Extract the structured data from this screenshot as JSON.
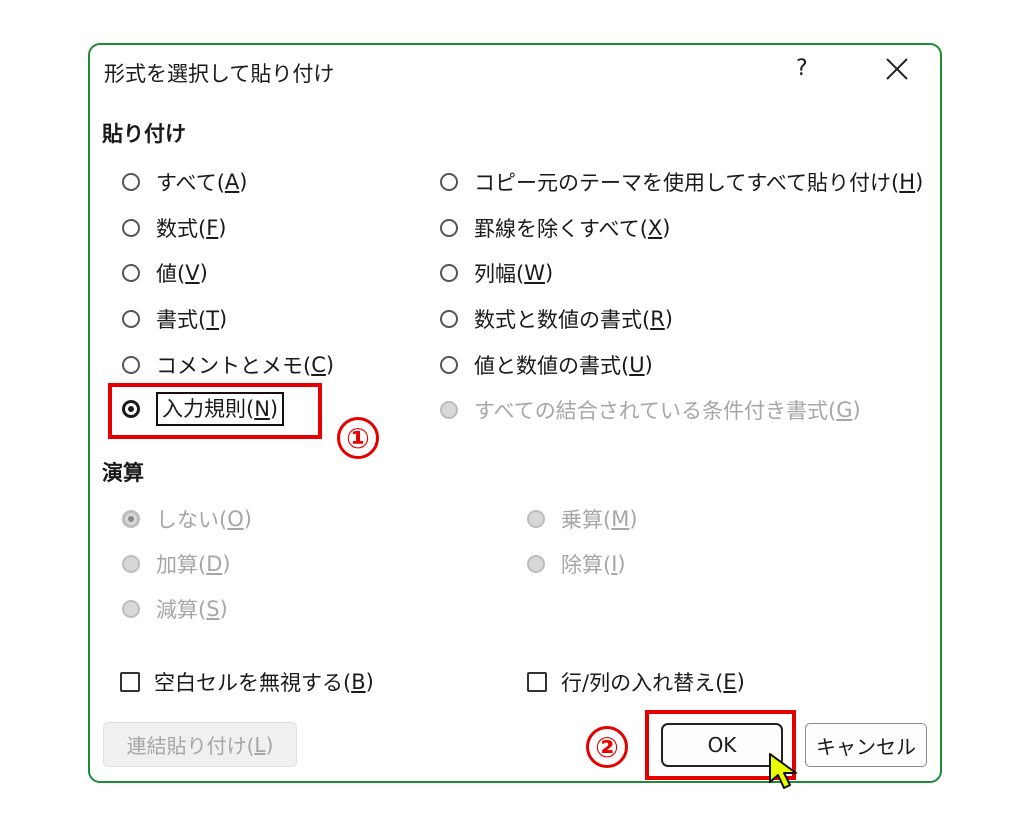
{
  "window": {
    "title": "形式を選択して貼り付け",
    "help_label": "?"
  },
  "paste_section": {
    "heading": "貼り付け",
    "left_options": [
      {
        "text": "すべて(",
        "key": "A",
        "end": ")"
      },
      {
        "text": "数式(",
        "key": "F",
        "end": ")"
      },
      {
        "text": "値(",
        "key": "V",
        "end": ")"
      },
      {
        "text": "書式(",
        "key": "T",
        "end": ")"
      },
      {
        "text": "コメントとメモ(",
        "key": "C",
        "end": ")"
      },
      {
        "text": "入力規則(",
        "key": "N",
        "end": ")"
      }
    ],
    "right_options": [
      {
        "text": "コピー元のテーマを使用してすべて貼り付け(",
        "key": "H",
        "end": ")"
      },
      {
        "text": "罫線を除くすべて(",
        "key": "X",
        "end": ")"
      },
      {
        "text": "列幅(",
        "key": "W",
        "end": ")"
      },
      {
        "text": "数式と数値の書式(",
        "key": "R",
        "end": ")"
      },
      {
        "text": "値と数値の書式(",
        "key": "U",
        "end": ")"
      },
      {
        "text": "すべての結合されている条件付き書式(",
        "key": "G",
        "end": ")"
      }
    ],
    "selected": "入力規則"
  },
  "operation_section": {
    "heading": "演算",
    "options": [
      {
        "text": "しない(",
        "key": "O",
        "end": ")"
      },
      {
        "text": "加算(",
        "key": "D",
        "end": ")"
      },
      {
        "text": "減算(",
        "key": "S",
        "end": ")"
      },
      {
        "text": "乗算(",
        "key": "M",
        "end": ")"
      },
      {
        "text": "除算(",
        "key": "I",
        "end": ")"
      }
    ],
    "selected": "しない"
  },
  "checkboxes": {
    "skip_blanks": {
      "text": "空白セルを無視する(",
      "key": "B",
      "end": ")",
      "checked": false
    },
    "transpose": {
      "text": "行/列の入れ替え(",
      "key": "E",
      "end": ")",
      "checked": false
    }
  },
  "buttons": {
    "paste_link": {
      "text": "連結貼り付け(",
      "key": "L",
      "end": ")"
    },
    "ok": "OK",
    "cancel": "キャンセル"
  },
  "annotations": {
    "step1": "①",
    "step2": "②",
    "highlight_color": "#e60000"
  },
  "colors": {
    "dialog_border": "#1f8a3a",
    "cursor_fill": "#e8ff00"
  }
}
